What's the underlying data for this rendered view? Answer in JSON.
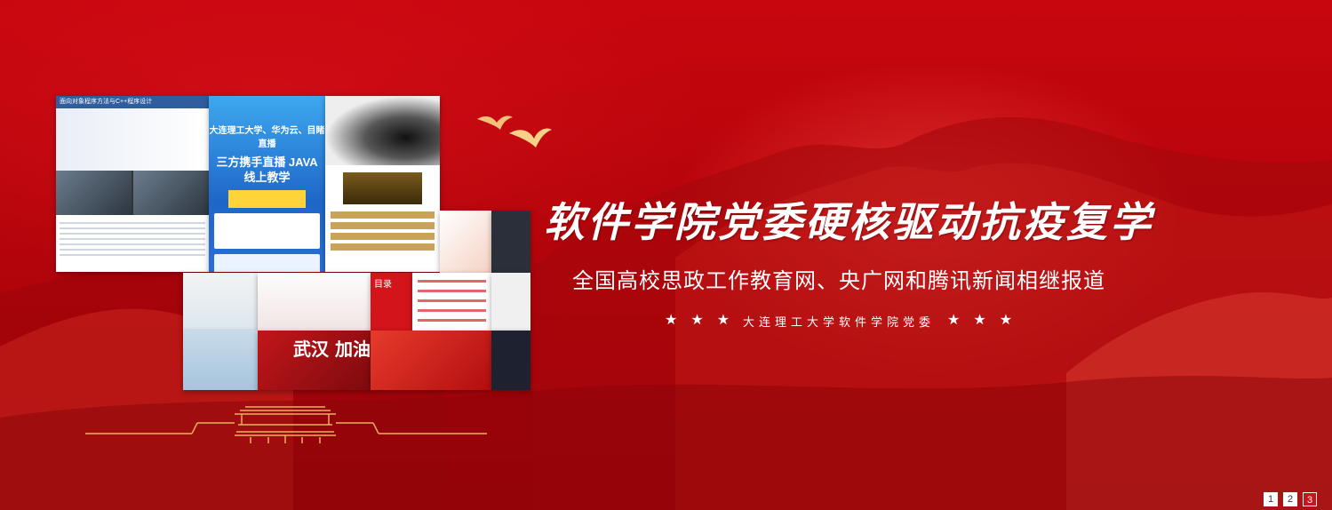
{
  "banner": {
    "title": "软件学院党委硬核驱动抗疫复学",
    "subtitle": "全国高校思政工作教育网、央广网和腾讯新闻相继报道",
    "organization": "大连理工大学软件学院党委",
    "star_glyph": "★"
  },
  "collage": {
    "panel1_heading": "面向对象程序方法与C++程序设计",
    "panel2_heading": "大连理工大学、华为云、目睹直播",
    "panel2_main": "三方携手直播 JAVA线上教学",
    "panel8_label": "目录",
    "panel12_text": "武汉 加油"
  },
  "pagination": {
    "pages": [
      "1",
      "2",
      "3"
    ],
    "active_index": 2
  },
  "colors": {
    "background": "#b8060c",
    "accent_gold": "#e8b25a",
    "active_page": "#c8141a"
  }
}
